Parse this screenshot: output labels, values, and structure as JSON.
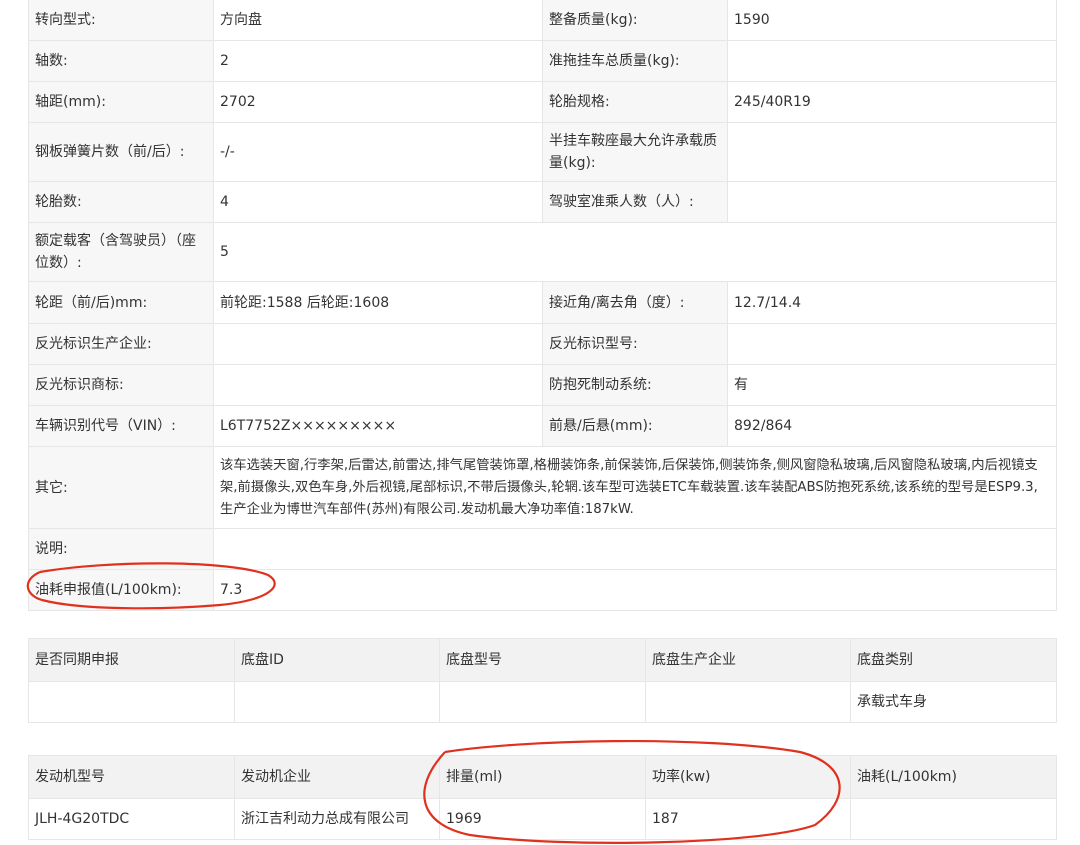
{
  "spec_rows": [
    {
      "label1": "转向型式:",
      "value1": "方向盘",
      "label2": "整备质量(kg):",
      "value2": "1590"
    },
    {
      "label1": "轴数:",
      "value1": "2",
      "label2": "准拖挂车总质量(kg):",
      "value2": ""
    },
    {
      "label1": "轴距(mm):",
      "value1": "2702",
      "label2": "轮胎规格:",
      "value2": "245/40R19"
    },
    {
      "label1": "钢板弹簧片数（前/后）:",
      "value1": "-/-",
      "label2": "半挂车鞍座最大允许承载质量(kg):",
      "value2": ""
    },
    {
      "label1": "轮胎数:",
      "value1": "4",
      "label2": "驾驶室准乘人数（人）:",
      "value2": ""
    },
    {
      "label1": "额定载客（含驾驶员）（座位数）:",
      "value1": "5"
    },
    {
      "label1": "轮距（前/后)mm:",
      "value1": "前轮距:1588 后轮距:1608",
      "label2": "接近角/离去角（度）:",
      "value2": "12.7/14.4"
    },
    {
      "label1": "反光标识生产企业:",
      "value1": "",
      "label2": "反光标识型号:",
      "value2": ""
    },
    {
      "label1": "反光标识商标:",
      "value1": "",
      "label2": "防抱死制动系统:",
      "value2": "有"
    },
    {
      "label1": "车辆识别代号（VIN）:",
      "value1": "L6T7752Z×××××××××",
      "label2": "前悬/后悬(mm):",
      "value2": "892/864"
    },
    {
      "label1": "其它:",
      "value1": "该车选装天窗,行李架,后雷达,前雷达,排气尾管装饰罩,格栅装饰条,前保装饰,后保装饰,侧装饰条,侧风窗隐私玻璃,后风窗隐私玻璃,内后视镜支架,前摄像头,双色车身,外后视镜,尾部标识,不带后摄像头,轮辋.该车型可选装ETC车载装置.该车装配ABS防抱死系统,该系统的型号是ESP9.3,生产企业为博世汽车部件(苏州)有限公司.发动机最大净功率值:187kW."
    },
    {
      "label1": "说明:",
      "value1": ""
    },
    {
      "label1": "油耗申报值(L/100km):",
      "value1": "7.3"
    }
  ],
  "chassis": {
    "headers": [
      "是否同期申报",
      "底盘ID",
      "底盘型号",
      "底盘生产企业",
      "底盘类别"
    ],
    "row": [
      "",
      "",
      "",
      "",
      "承载式车身"
    ]
  },
  "engine": {
    "headers": [
      "发动机型号",
      "发动机企业",
      "排量(ml)",
      "功率(kw)",
      "油耗(L/100km)"
    ],
    "row": [
      "JLH-4G20TDC",
      "浙江吉利动力总成有限公司",
      "1969",
      "187",
      ""
    ]
  },
  "colors": {
    "annotation": "#e0301e",
    "label_bg": "#f7f7f7",
    "header_bg": "#f2f2f2",
    "border": "#e6e6e6"
  }
}
